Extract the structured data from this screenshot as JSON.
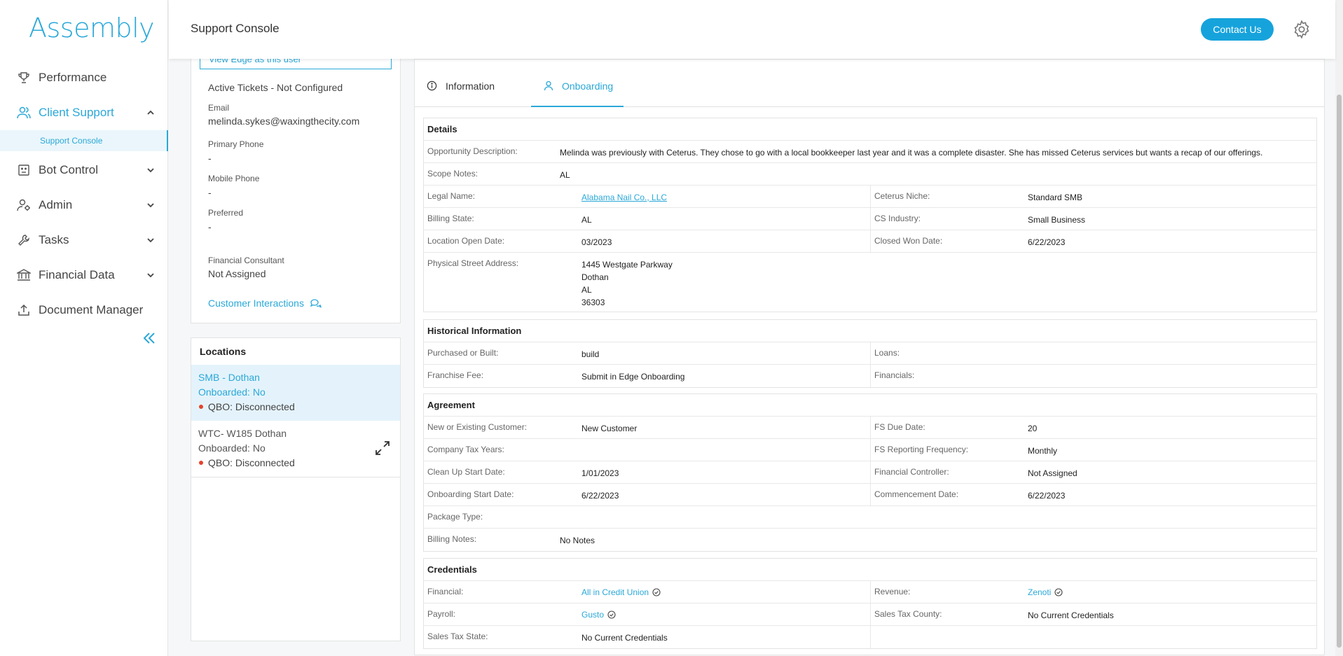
{
  "app": {
    "logo": "Assembly"
  },
  "sidebar": {
    "items": [
      {
        "label": "Performance",
        "icon": "trophy-icon"
      },
      {
        "label": "Client Support",
        "icon": "users-icon",
        "active": true
      },
      {
        "label": "Bot Control",
        "icon": "bot-icon"
      },
      {
        "label": "Admin",
        "icon": "admin-icon"
      },
      {
        "label": "Tasks",
        "icon": "wrench-icon"
      },
      {
        "label": "Financial Data",
        "icon": "bank-icon"
      },
      {
        "label": "Document Manager",
        "icon": "upload-icon"
      }
    ],
    "sub_item": "Support Console"
  },
  "header": {
    "title": "Support Console",
    "contact_label": "Contact Us"
  },
  "user": {
    "view_edge": "View Edge as this user",
    "active_tickets": "Active Tickets - Not Configured",
    "email_label": "Email",
    "email": "melinda.sykes@waxingthecity.com",
    "primary_phone_label": "Primary Phone",
    "primary_phone": "-",
    "mobile_phone_label": "Mobile Phone",
    "mobile_phone": "-",
    "preferred_label": "Preferred",
    "preferred": "-",
    "fc_label": "Financial Consultant",
    "fc": "Not Assigned",
    "interactions": "Customer Interactions"
  },
  "locations": {
    "title": "Locations",
    "items": [
      {
        "name": "SMB - Dothan",
        "onboarded": "Onboarded: No",
        "qbo": "QBO: Disconnected"
      },
      {
        "name": "WTC- W185 Dothan",
        "onboarded": "Onboarded: No",
        "qbo": "QBO: Disconnected"
      }
    ]
  },
  "tabs": {
    "information": "Information",
    "onboarding": "Onboarding"
  },
  "details": {
    "title": "Details",
    "opp_desc_label": "Opportunity Description:",
    "opp_desc": "Melinda was previously with Ceterus. They chose to go with a local bookkeeper last year and it was a complete disaster. She has missed Ceterus services but wants a recap of our offerings.",
    "scope_label": "Scope Notes:",
    "scope": "AL",
    "legal_name_label": "Legal Name:",
    "legal_name": "Alabama Nail Co., LLC",
    "niche_label": "Ceterus Niche:",
    "niche": "Standard SMB",
    "billing_state_label": "Billing State:",
    "billing_state": "AL",
    "cs_industry_label": "CS Industry:",
    "cs_industry": "Small Business",
    "open_date_label": "Location Open Date:",
    "open_date": "03/2023",
    "closed_won_label": "Closed Won Date:",
    "closed_won": "6/22/2023",
    "address_label": "Physical Street Address:",
    "address": [
      "1445 Westgate Parkway",
      "Dothan",
      "AL",
      "36303"
    ]
  },
  "historical": {
    "title": "Historical Information",
    "purchased_label": "Purchased or Built:",
    "purchased": "build",
    "loans_label": "Loans:",
    "fee_label": "Franchise Fee:",
    "fee": "Submit in Edge Onboarding",
    "financials_label": "Financials:"
  },
  "agreement": {
    "title": "Agreement",
    "customer_label": "New or Existing Customer:",
    "customer": "New Customer",
    "fs_due_label": "FS Due Date:",
    "fs_due": "20",
    "tax_years_label": "Company Tax Years:",
    "fs_freq_label": "FS Reporting Frequency:",
    "fs_freq": "Monthly",
    "cleanup_label": "Clean Up Start Date:",
    "cleanup": "1/01/2023",
    "controller_label": "Financial Controller:",
    "controller": "Not Assigned",
    "onboarding_label": "Onboarding Start Date:",
    "onboarding": "6/22/2023",
    "commencement_label": "Commencement Date:",
    "commencement": "6/22/2023",
    "package_label": "Package Type:",
    "billing_notes_label": "Billing Notes:",
    "billing_notes": "No Notes"
  },
  "credentials": {
    "title": "Credentials",
    "financial_label": "Financial:",
    "financial": "All in Credit Union",
    "revenue_label": "Revenue:",
    "revenue": "Zenoti",
    "payroll_label": "Payroll:",
    "payroll": "Gusto",
    "sales_tax_county_label": "Sales Tax County:",
    "sales_tax_county": "No Current Credentials",
    "sales_tax_state_label": "Sales Tax State:",
    "sales_tax_state": "No Current Credentials"
  },
  "colors": {
    "accent": "#2aa8d8",
    "button": "#16a3dc",
    "alert": "#e4432c",
    "selected_bg": "#e4f3fb"
  }
}
